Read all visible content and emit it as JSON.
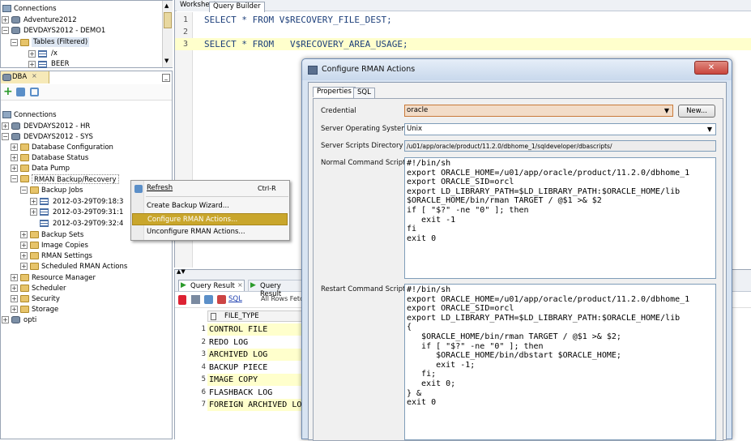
{
  "connections_panel": {
    "root": "Connections",
    "items": [
      "Adventure2012",
      "DEVDAYS2012 - DEMO1",
      "Tables (Filtered)",
      "/x",
      "BEER"
    ]
  },
  "dba_panel": {
    "tab": "DBA",
    "tree": {
      "root": "Connections",
      "hr": "DEVDAYS2012 - HR",
      "sys": "DEVDAYS2012 - SYS",
      "db_config": "Database Configuration",
      "db_status": "Database Status",
      "data_pump": "Data Pump",
      "rman": "RMAN Backup/Recovery",
      "backup_jobs": "Backup Jobs",
      "jobs": [
        "2012-03-29T09:18:3",
        "2012-03-29T09:31:1",
        "2012-03-29T09:32:4"
      ],
      "backup_sets": "Backup Sets",
      "image_copies": "Image Copies",
      "rman_settings": "RMAN Settings",
      "scheduled": "Scheduled RMAN Actions",
      "resource_manager": "Resource Manager",
      "scheduler": "Scheduler",
      "security": "Security",
      "storage": "Storage",
      "opti": "opti"
    }
  },
  "context_menu": {
    "refresh": "Refresh",
    "refresh_shortcut": "Ctrl-R",
    "create_wizard": "Create Backup Wizard...",
    "configure": "Configure RMAN Actions...",
    "unconfigure": "Unconfigure RMAN Actions..."
  },
  "editor": {
    "tabs": [
      "Worksheet",
      "Query Builder"
    ],
    "lines": [
      {
        "num": "1",
        "text": "SELECT * FROM V$RECOVERY_FILE_DEST;"
      },
      {
        "num": "2",
        "text": ""
      },
      {
        "num": "3",
        "text": "SELECT * FROM   V$RECOVERY_AREA_USAGE;"
      }
    ]
  },
  "results": {
    "tabs": [
      "Query Result",
      "Query Result"
    ],
    "toolbar_sql": "SQL",
    "toolbar_status": "All Rows Fetc",
    "column": "FILE_TYPE",
    "rows": [
      {
        "n": "1",
        "v": "CONTROL FILE"
      },
      {
        "n": "2",
        "v": "REDO LOG"
      },
      {
        "n": "3",
        "v": "ARCHIVED LOG"
      },
      {
        "n": "4",
        "v": "BACKUP PIECE"
      },
      {
        "n": "5",
        "v": "IMAGE COPY"
      },
      {
        "n": "6",
        "v": "FLASHBACK LOG"
      },
      {
        "n": "7",
        "v": "FOREIGN ARCHIVED LO"
      }
    ]
  },
  "dialog": {
    "title": "Configure RMAN Actions",
    "tabs": [
      "Properties",
      "SQL"
    ],
    "credential_label": "Credential",
    "credential_value": "oracle",
    "new_button": "New...",
    "os_label": "Server Operating System",
    "os_value": "Unix",
    "scripts_dir_label": "Server Scripts Directory",
    "scripts_dir_value": "/u01/app/oracle/product/11.2.0/dbhome_1/sqldeveloper/dbascripts/",
    "normal_label": "Normal Command Script",
    "normal_script": "#!/bin/sh\nexport ORACLE_HOME=/u01/app/oracle/product/11.2.0/dbhome_1\nexport ORACLE_SID=orcl\nexport LD_LIBRARY_PATH=$LD_LIBRARY_PATH:$ORACLE_HOME/lib\n$ORACLE_HOME/bin/rman TARGET / @$1 >& $2\nif [ \"$?\" -ne \"0\" ]; then\n   exit -1\nfi\nexit 0",
    "restart_label": "Restart Command Script",
    "restart_script": "#!/bin/sh\nexport ORACLE_HOME=/u01/app/oracle/product/11.2.0/dbhome_1\nexport ORACLE_SID=orcl\nexport LD_LIBRARY_PATH=$LD_LIBRARY_PATH:$ORACLE_HOME/lib\n{\n   $ORACLE_HOME/bin/rman TARGET / @$1 >& $2;\n   if [ \"$?\" -ne \"0\" ]; then\n      $ORACLE_HOME/bin/dbstart $ORACLE_HOME;\n      exit -1;\n   fi;\n   exit 0;\n} &\nexit 0"
  },
  "colors": {
    "highlight": "#ffffcc",
    "menu_selected": "#c9a62c",
    "dialog_close": "#c9463d"
  }
}
